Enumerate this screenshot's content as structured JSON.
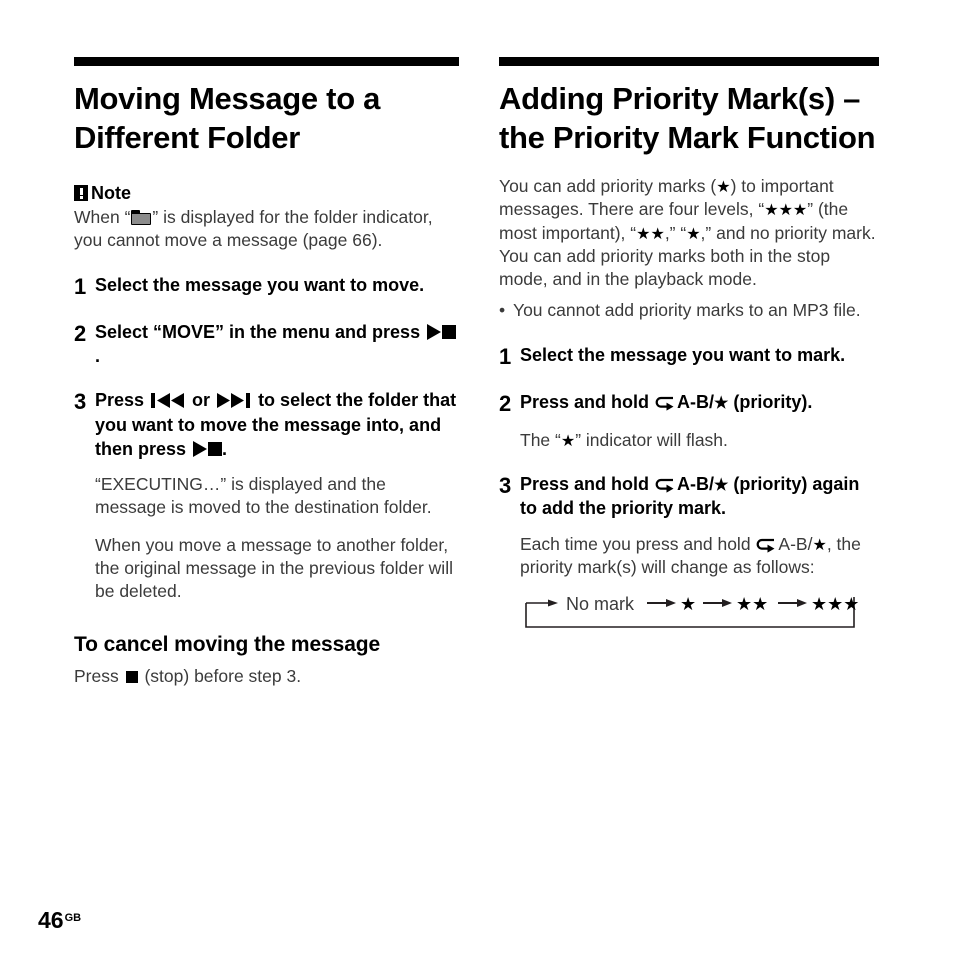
{
  "page": {
    "number": "46",
    "region_code": "GB"
  },
  "left_column": {
    "title": "Moving Message to a Different Folder",
    "note": {
      "label": "Note",
      "icon": "note-exclamation-icon",
      "text_before_icon": "When “",
      "icon_inline": "folder-icon",
      "text_after_icon": "” is displayed for the folder indicator, you cannot move a message (page 66)."
    },
    "steps": [
      {
        "number": "1",
        "text": "Select the message you want to move.",
        "sub": []
      },
      {
        "number": "2",
        "text_parts": {
          "a": "Select “MOVE” in the menu and press ",
          "b": "."
        },
        "sub": []
      },
      {
        "number": "3",
        "text_parts": {
          "a": "Press ",
          "b": " or ",
          "c": " to select the folder that you want to move the message into, and then press ",
          "d": "."
        },
        "sub": [
          "“EXECUTING…” is displayed and the message is moved to the destination folder.",
          "When you move a message to another folder, the original message in the previous folder will be deleted."
        ]
      }
    ],
    "subsection": {
      "heading": "To cancel moving the message",
      "text_parts": {
        "a": "Press ",
        "b": " (stop) before step 3."
      }
    }
  },
  "right_column": {
    "title": "Adding Priority Mark(s) – the Priority Mark Function",
    "intro_parts": {
      "a": "You can add priority marks (",
      "b": "★",
      "c": ") to important messages. There are four levels, “",
      "d": "★★★",
      "e": "” (the most important), “",
      "f": "★★",
      "g": ",” “",
      "h": "★",
      "i": ",” and no priority mark. You can add priority marks both in the stop mode, and in the playback mode."
    },
    "bullets": [
      "You cannot add priority marks to an MP3 file."
    ],
    "steps": [
      {
        "number": "1",
        "text": "Select the message you want to mark.",
        "sub": []
      },
      {
        "number": "2",
        "text_parts": {
          "a": "Press and hold ",
          "b": "A-B/",
          "c": "★",
          "d": " (priority)."
        },
        "sub_parts": {
          "a": "The “",
          "b": "★",
          "c": "” indicator will flash."
        }
      },
      {
        "number": "3",
        "text_parts": {
          "a": "Press and hold ",
          "b": "A-B/",
          "c": "★",
          "d": " (priority) again to add the priority mark."
        },
        "sub_parts": {
          "a": "Each time you press and hold ",
          "b": "A-B/",
          "c": "★",
          "d": ", the priority mark(s) will change as follows:"
        }
      }
    ],
    "cycle_diagram": {
      "nodes": [
        "No mark",
        "★",
        "★★",
        "★★★"
      ],
      "loops": true
    }
  }
}
